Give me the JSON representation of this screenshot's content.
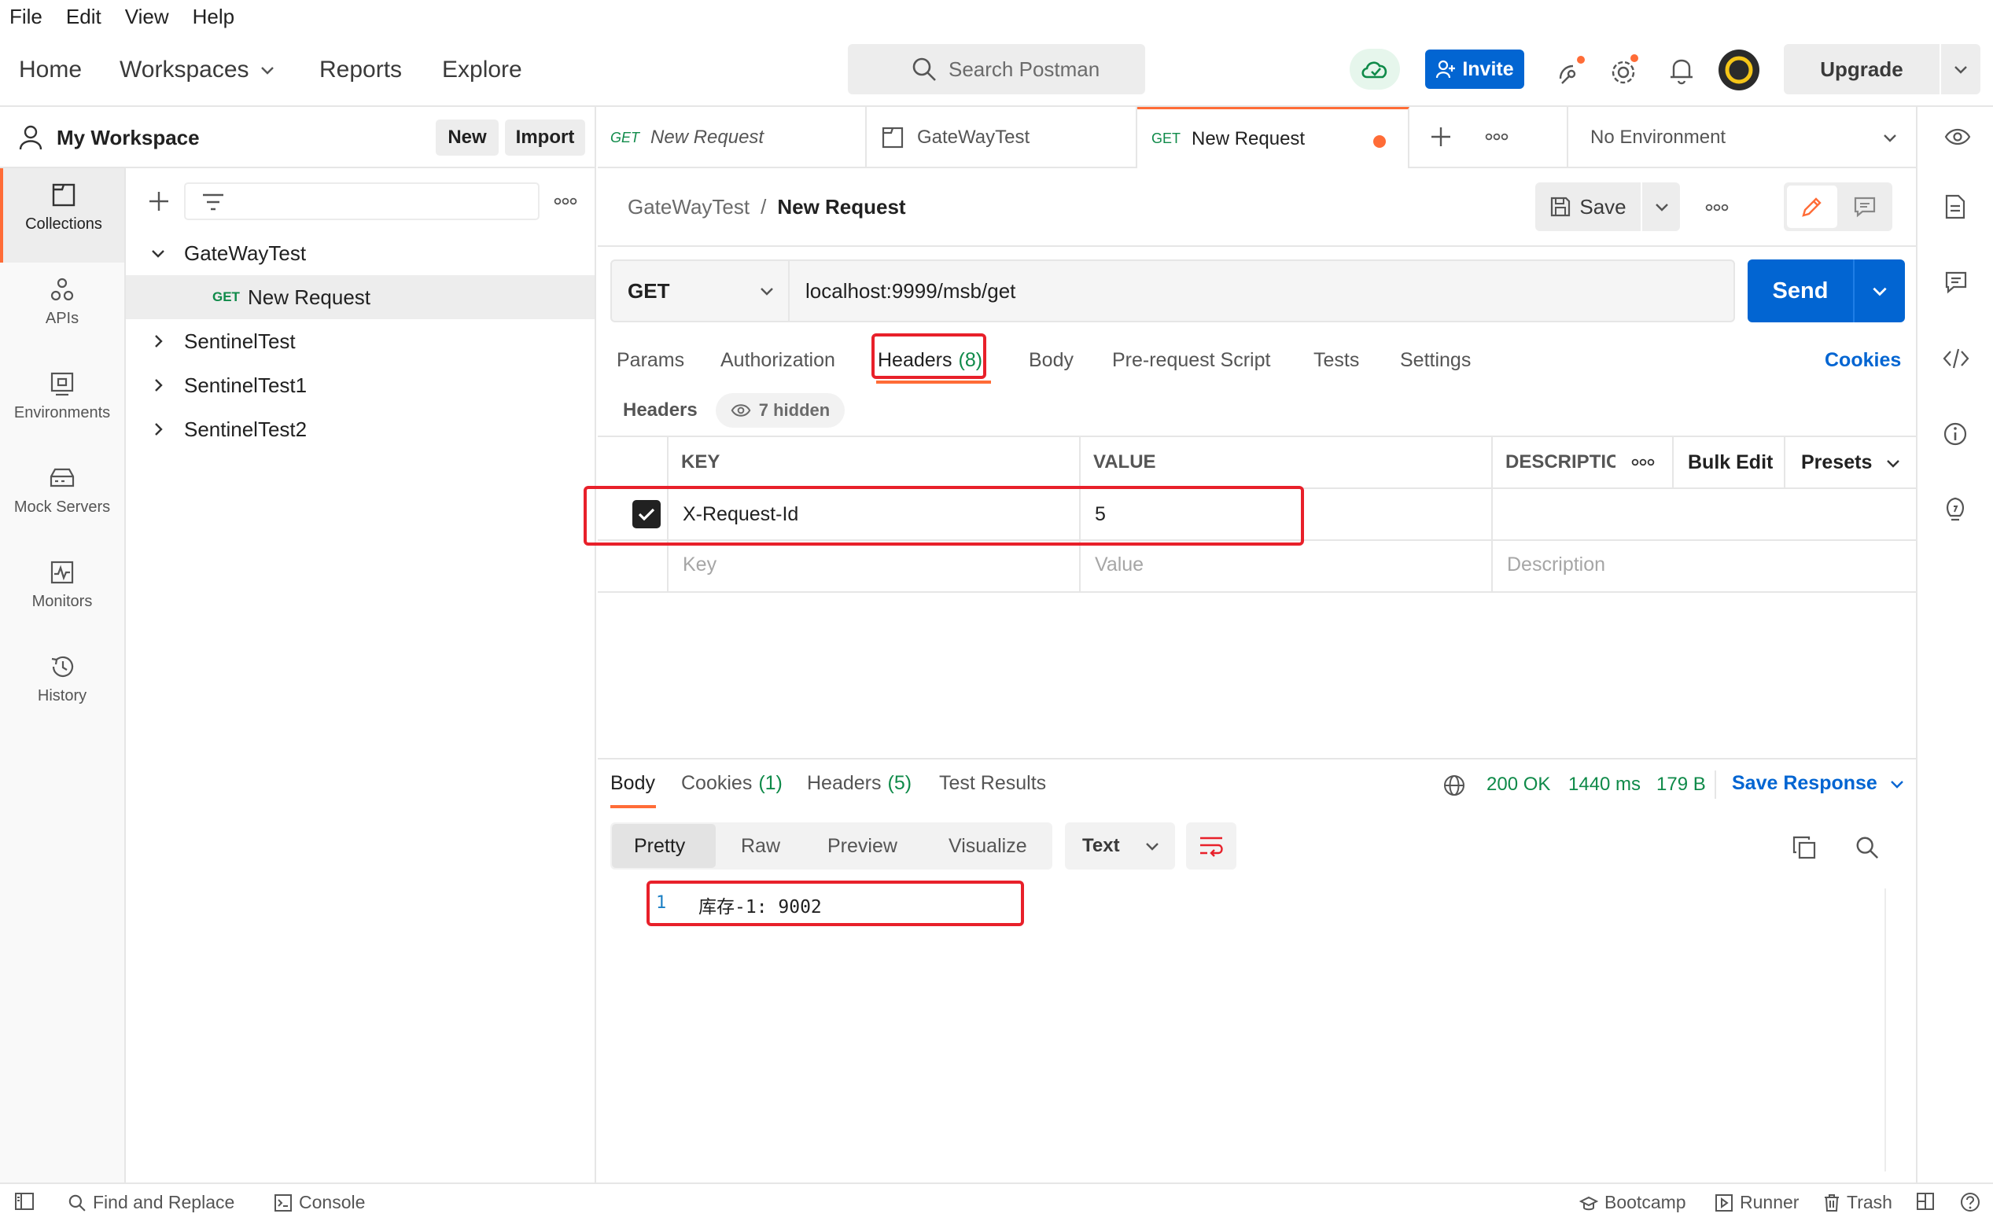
{
  "menu": [
    "File",
    "Edit",
    "View",
    "Help"
  ],
  "nav": {
    "home": "Home",
    "workspaces": "Workspaces",
    "reports": "Reports",
    "explore": "Explore",
    "search_placeholder": "Search Postman",
    "invite": "Invite",
    "upgrade": "Upgrade"
  },
  "workspace": {
    "title": "My Workspace",
    "new": "New",
    "import": "Import"
  },
  "rail": [
    "Collections",
    "APIs",
    "Environments",
    "Mock Servers",
    "Monitors",
    "History"
  ],
  "tree": {
    "root": "GateWayTest",
    "child_method": "GET",
    "child": "New Request",
    "others": [
      "SentinelTest",
      "SentinelTest1",
      "SentinelTest2"
    ]
  },
  "tabs": [
    {
      "method": "GET",
      "label": "New Request"
    },
    {
      "method": "",
      "label": "GateWayTest"
    },
    {
      "method": "GET",
      "label": "New Request"
    }
  ],
  "environment": "No Environment",
  "breadcrumb": {
    "parent": "GateWayTest",
    "sep": "/",
    "current": "New Request"
  },
  "save": "Save",
  "request": {
    "method": "GET",
    "url": "localhost:9999/msb/get",
    "send": "Send"
  },
  "req_tabs": {
    "params": "Params",
    "authorization": "Authorization",
    "headers": "Headers",
    "headers_count": "(8)",
    "body": "Body",
    "prescript": "Pre-request Script",
    "tests": "Tests",
    "settings": "Settings",
    "cookies": "Cookies"
  },
  "headers_section": {
    "title": "Headers",
    "hidden": "7 hidden"
  },
  "headers_table": {
    "col_key": "KEY",
    "col_value": "VALUE",
    "col_desc": "DESCRIPTIC",
    "bulk_edit": "Bulk Edit",
    "presets": "Presets",
    "rows": [
      {
        "key": "X-Request-Id",
        "value": "5",
        "checked": true
      }
    ],
    "placeholder": {
      "key": "Key",
      "value": "Value",
      "desc": "Description"
    }
  },
  "response": {
    "tab_body": "Body",
    "tab_cookies": "Cookies",
    "cookies_count": "(1)",
    "tab_headers": "Headers",
    "headers_count": "(5)",
    "tab_tests": "Test Results",
    "status": "200 OK",
    "time": "1440 ms",
    "size": "179 B",
    "save_response": "Save Response",
    "formats": [
      "Pretty",
      "Raw",
      "Preview",
      "Visualize"
    ],
    "type": "Text",
    "line_no": "1",
    "line_text": "库存-1: 9002"
  },
  "status_bar": {
    "find": "Find and Replace",
    "console": "Console",
    "bootcamp": "Bootcamp",
    "runner": "Runner",
    "trash": "Trash"
  },
  "colors": {
    "accent": "#ff6c37",
    "primary": "#0265d2",
    "success": "#0f8a49",
    "highlight": "#e8202a"
  }
}
